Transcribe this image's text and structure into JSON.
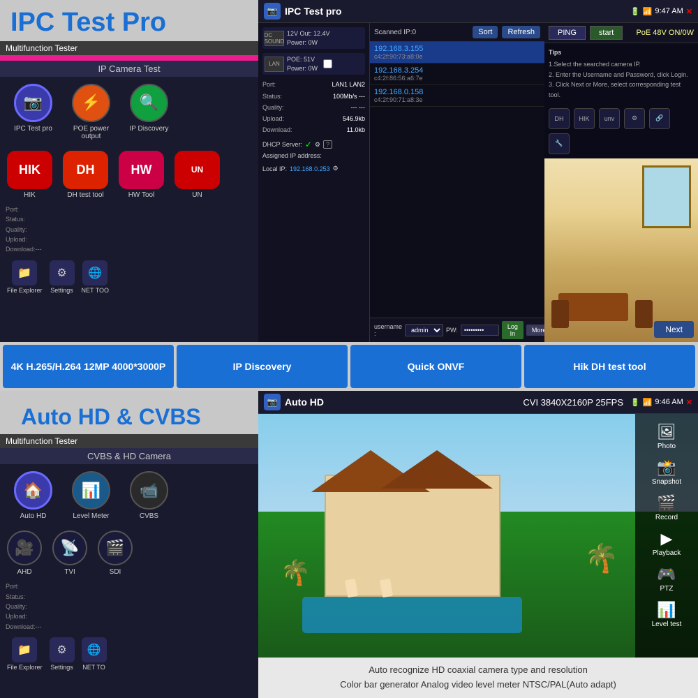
{
  "top": {
    "left": {
      "title": "IPC Test Pro",
      "multifunction": "Multifunction Tester",
      "screen_title": "IP Camera Test",
      "icons": [
        {
          "label": "IPC Test pro",
          "type": "selected",
          "icon": "📷"
        },
        {
          "label": "POE power output",
          "type": "power",
          "icon": "⚡"
        },
        {
          "label": "IP Discovery",
          "type": "green",
          "icon": "🔍"
        }
      ],
      "brands": [
        {
          "label": "HIK",
          "class": "brand-hik",
          "text": "HIK"
        },
        {
          "label": "DH test tool",
          "class": "brand-dh",
          "text": "DH"
        },
        {
          "label": "HW Tool",
          "class": "brand-hw",
          "text": "HW"
        },
        {
          "label": "UN",
          "class": "brand-hik",
          "text": "UN"
        }
      ],
      "status": {
        "port": "Port:",
        "status": "Status:",
        "quality": "Quality:",
        "upload": "Upload:",
        "download": "Download:---"
      },
      "bottom_icons": [
        {
          "label": "File Explorer",
          "icon": "📁"
        },
        {
          "label": "Settings",
          "icon": "⚙"
        },
        {
          "label": "NET TOO",
          "icon": "🌐"
        }
      ]
    },
    "right": {
      "titlebar": {
        "app_name": "IPC Test pro",
        "time": "9:47 AM"
      },
      "left_panel": {
        "v12_out": "12V Out: 12.4V",
        "power_0w": "Power: 0W",
        "poe_51v": "POE: 51V",
        "power_0w2": "Power: 0W",
        "port_label": "Port:",
        "port_val": "LAN1  LAN2",
        "status_label": "Status:",
        "status_val": "100Mb/s  ---",
        "quality_label": "Quality:",
        "quality_val": "---  ---",
        "upload_label": "Upload:",
        "upload_val": "546.9kb",
        "download_label": "Download:",
        "download_val": "11.0kb",
        "dhcp_label": "DHCP Server:",
        "assigned_label": "Assigned IP address:",
        "local_ip_label": "Local IP:",
        "local_ip_val": "192.168.0.253"
      },
      "center_panel": {
        "scanned_label": "Scanned IP:0",
        "sort_btn": "Sort",
        "refresh_btn": "Refresh",
        "ip_list": [
          {
            "ip": "192.168.3.155",
            "mac": "c4:2f:90:73:a8:0e",
            "selected": true
          },
          {
            "ip": "192.168.3.254",
            "mac": "c4:2f:86:56:a6:7e",
            "selected": false
          },
          {
            "ip": "192.168.0.158",
            "mac": "c4:2f:90:71:a8:3e",
            "selected": false
          }
        ],
        "username_label": "username :",
        "username_val": "admin",
        "pw_label": "PW:",
        "pw_val": "••••••••••",
        "login_btn": "Log In",
        "more_btn": "More"
      },
      "right_panel": {
        "ping_btn": "PING",
        "start_btn": "start",
        "poe_label": "PoE 48V ON/0W",
        "tips_title": "Tips",
        "tip1": "1.Select the searched camera IP.",
        "tip2": "2. Enter the Username and Password, click Login.",
        "tip3": "3. Click Next or More, select corresponding test tool.",
        "vendors": [
          "DH",
          "HIK",
          "unv",
          "⚙",
          "🔗",
          "🔧"
        ],
        "next_btn": "Next"
      }
    }
  },
  "features": [
    {
      "label": "4K H.265/H.264 12MP 4000*3000P"
    },
    {
      "label": "IP Discovery"
    },
    {
      "label": "Quick ONVF"
    },
    {
      "label": "Hik DH test tool"
    }
  ],
  "bottom": {
    "left": {
      "title": "Auto HD & CVBS",
      "multifunction": "Multifunction Tester",
      "screen_title": "CVBS & HD Camera",
      "icons": [
        {
          "label": "Auto HD",
          "type": "selected",
          "icon": "📷"
        },
        {
          "label": "Level Meter",
          "type": "normal",
          "icon": "📊"
        },
        {
          "label": "CVBS",
          "type": "normal",
          "icon": "📹"
        }
      ],
      "second_icons": [
        {
          "label": "AHD",
          "icon": "📷"
        },
        {
          "label": "TVI",
          "icon": "📡"
        },
        {
          "label": "SDI",
          "icon": "🎥"
        }
      ],
      "status": {
        "port": "Port:",
        "status": "Status:",
        "quality": "Quality:",
        "upload": "Upload:",
        "download": "Download:---"
      },
      "bottom_icons": [
        {
          "label": "File Explorer",
          "icon": "📁"
        },
        {
          "label": "Settings",
          "icon": "⚙"
        },
        {
          "label": "NET TO",
          "icon": "🌐"
        }
      ]
    },
    "right": {
      "titlebar": {
        "app_name": "Auto HD",
        "cvi_label": "CVI 3840X2160P 25FPS",
        "time": "9:46 AM"
      },
      "sidebar_buttons": [
        {
          "label": "Photo",
          "icon": "🖼"
        },
        {
          "label": "Snapshot",
          "icon": "📸"
        },
        {
          "label": "Record",
          "icon": "🎬"
        },
        {
          "label": "Playback",
          "icon": "▶"
        },
        {
          "label": "PTZ",
          "icon": "🎮"
        },
        {
          "label": "Level test",
          "icon": "📊"
        }
      ]
    },
    "caption": {
      "line1": "Auto recognize HD coaxial camera type and resolution",
      "line2": "Color bar generator  Analog video level meter NTSC/PAL(Auto adapt)"
    }
  }
}
